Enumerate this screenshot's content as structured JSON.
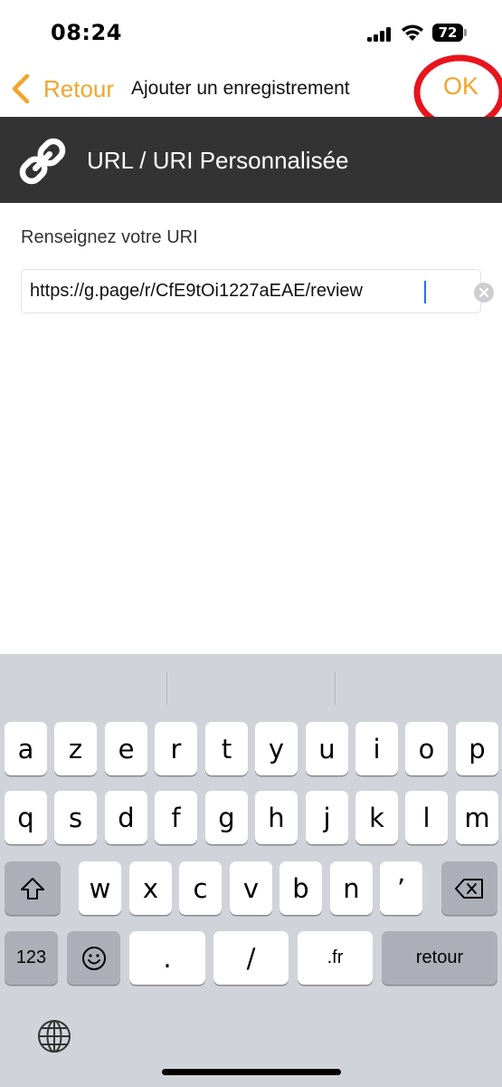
{
  "status_bar": {
    "time": "08:24",
    "battery": "72"
  },
  "nav": {
    "back_label": "Retour",
    "title": "Ajouter un enregistrement",
    "ok_label": "OK"
  },
  "header": {
    "title": "URL / URI Personnalisée",
    "icon": "link-icon"
  },
  "form": {
    "label": "Renseignez votre URI",
    "url_value": "https://g.page/r/CfE9tOi1227aEAE/review"
  },
  "keyboard": {
    "row1": [
      "a",
      "z",
      "e",
      "r",
      "t",
      "y",
      "u",
      "i",
      "o",
      "p"
    ],
    "row2": [
      "q",
      "s",
      "d",
      "f",
      "g",
      "h",
      "j",
      "k",
      "l",
      "m"
    ],
    "row3": [
      "w",
      "x",
      "c",
      "v",
      "b",
      "n",
      "’"
    ],
    "numbers_label": "123",
    "dot_label": ".",
    "slash_label": "/",
    "fr_label": ".fr",
    "return_label": "retour"
  },
  "colors": {
    "accent": "#f2a52c",
    "header_bg": "#333333",
    "annotation_circle": "#e8141c",
    "keyboard_bg": "#d1d3da"
  }
}
